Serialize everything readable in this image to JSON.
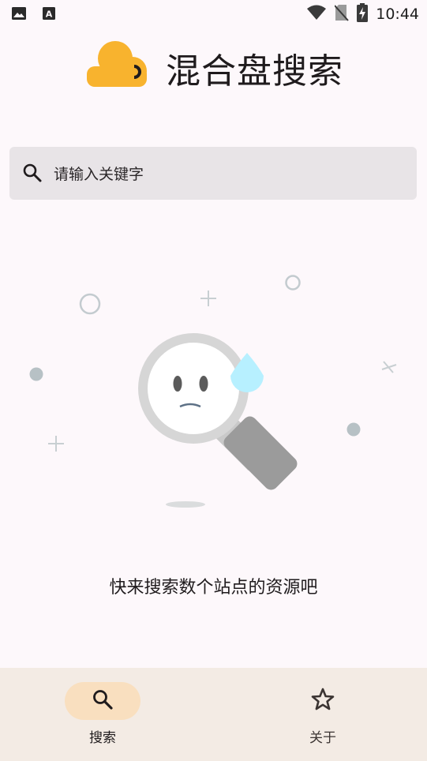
{
  "status_bar": {
    "time": "10:44",
    "left_icons": [
      "image-icon",
      "text-a-icon"
    ],
    "right_icons": [
      "wifi-icon",
      "no-sim-icon",
      "battery-charging-icon"
    ]
  },
  "header": {
    "logo_icon": "cloud-logo-icon",
    "title": "混合盘搜索",
    "logo_color": "#f8b32e"
  },
  "search": {
    "placeholder": "请输入关键字",
    "value": ""
  },
  "empty_state": {
    "illustration": "sad-magnifier-illustration",
    "message": "快来搜索数个站点的资源吧"
  },
  "bottom_nav": {
    "items": [
      {
        "label": "搜索",
        "icon": "search-icon",
        "active": true
      },
      {
        "label": "关于",
        "icon": "star-icon",
        "active": false
      }
    ],
    "active_color": "#f9dfbf"
  }
}
